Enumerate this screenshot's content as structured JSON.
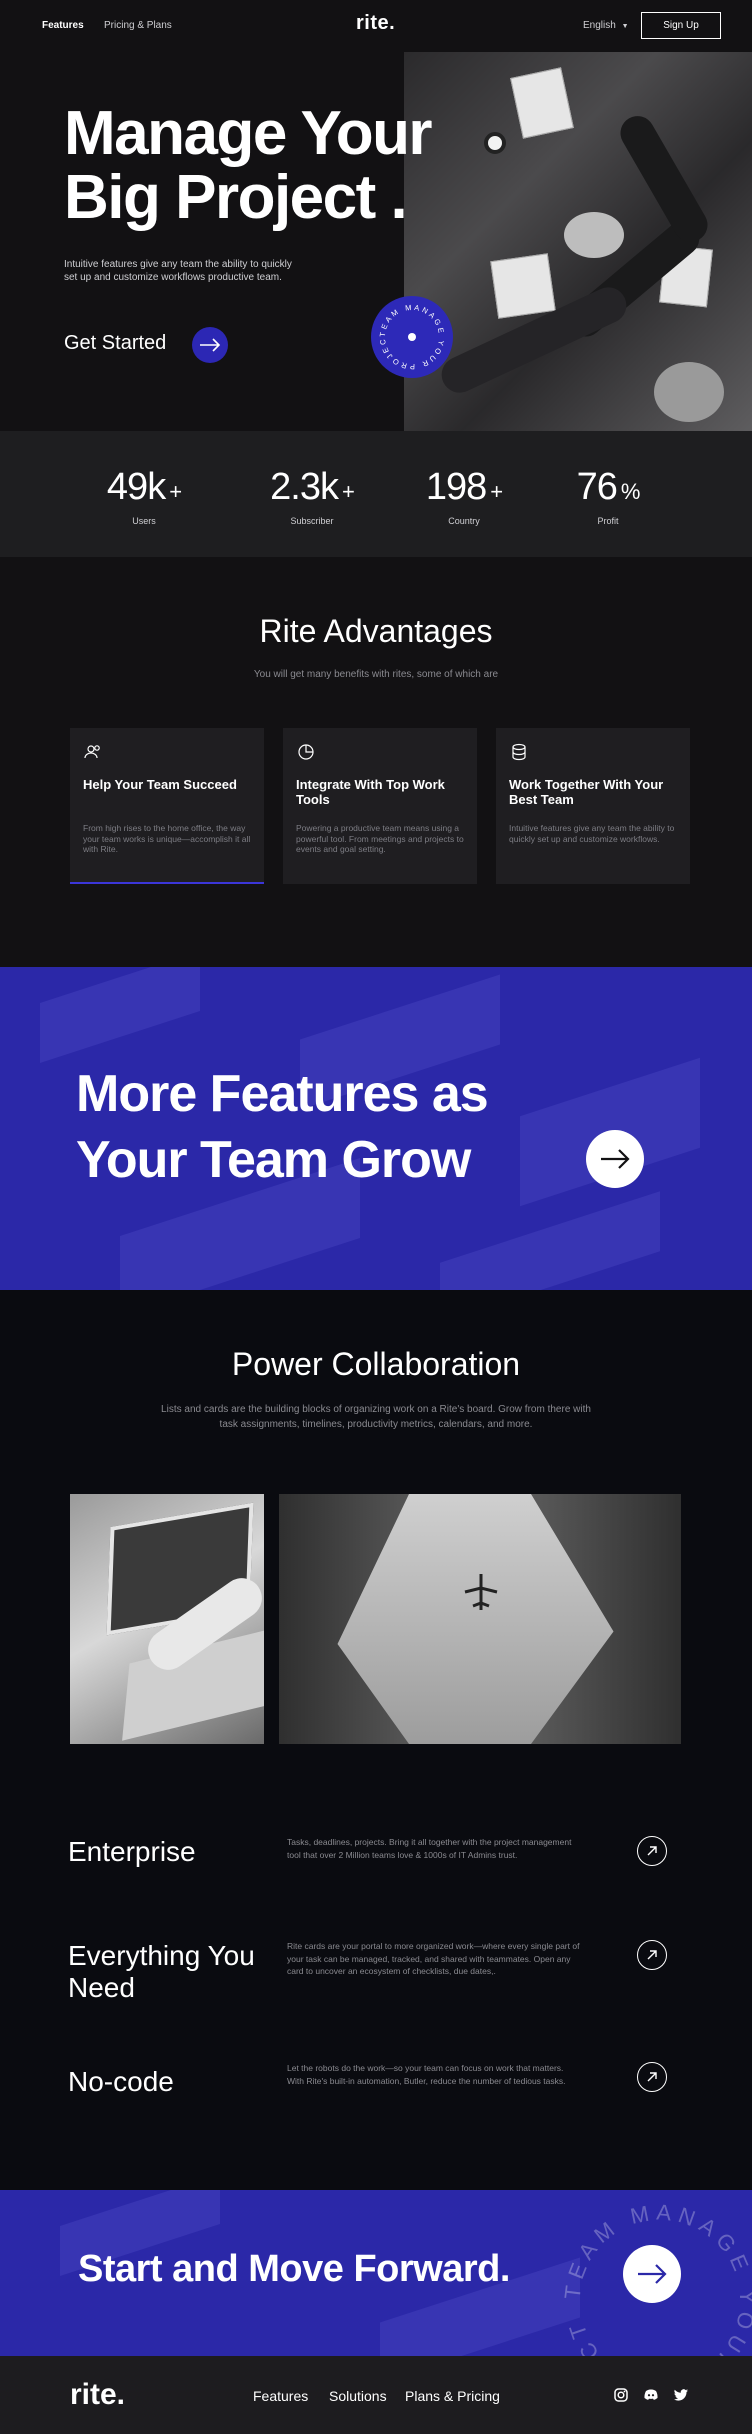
{
  "nav": {
    "features": "Features",
    "pricing": "Pricing & Plans",
    "logo": "rite.",
    "language": "English",
    "signup": "Sign Up"
  },
  "hero": {
    "title_line1": "Manage Your",
    "title_line2": "Big Project .",
    "subtitle": "Intuitive features give any team the ability to quickly set up and customize workflows productive team.",
    "cta": "Get Started",
    "badge_text": "TEAM MANAGE YOUR PROJECT"
  },
  "stats": [
    {
      "value": "49k",
      "suffix": "+",
      "label": "Users"
    },
    {
      "value": "2.3k",
      "suffix": "+",
      "label": "Subscriber"
    },
    {
      "value": "198",
      "suffix": "+",
      "label": "Country"
    },
    {
      "value": "76",
      "suffix": "%",
      "label": "Profit"
    }
  ],
  "advantages": {
    "title": "Rite Advantages",
    "subtitle": "You will get many benefits with rites, some of which are",
    "cards": [
      {
        "icon": "users-icon",
        "title": "Help Your Team Succeed",
        "text": "From high rises to the home office, the way your team works is unique—accomplish it all with Rite."
      },
      {
        "icon": "pie-chart-icon",
        "title": "Integrate With Top Work Tools",
        "text": "Powering a productive team means using a powerful tool. From meetings and projects to events and goal setting."
      },
      {
        "icon": "database-icon",
        "title": "Work Together With Your Best Team",
        "text": "Intuitive features give any team the ability to quickly set up and customize workflows."
      }
    ]
  },
  "features_banner": {
    "line1": "More Features as",
    "line2": "Your Team Grow"
  },
  "collab": {
    "title": "Power Collaboration",
    "subtitle": "Lists and cards are the building blocks of organizing work on a Rite's board. Grow from there with task assignments, timelines, productivity metrics, calendars, and more.",
    "rows": [
      {
        "title": "Enterprise",
        "text": "Tasks, deadlines, projects. Bring it all together with the project management tool that over 2 Million teams love & 1000s of IT Admins trust."
      },
      {
        "title": "Everything You Need",
        "text": "Rite cards are your portal to more organized work—where every single part of your task can be managed, tracked, and shared with teammates. Open any card to uncover an ecosystem of checklists, due dates,."
      },
      {
        "title": "No-code",
        "text": "Let the robots do the work—so your team can focus on work that matters. With Rite's built-in automation, Butler, reduce the number of tedious tasks."
      }
    ]
  },
  "start_banner": {
    "title": "Start and Move Forward.",
    "ring_text": "TEAM MANAGE YOUR PROJECT"
  },
  "footer": {
    "logo": "rite.",
    "links": [
      "Features",
      "Solutions",
      "Plans & Pricing"
    ],
    "social": [
      "instagram-icon",
      "discord-icon",
      "twitter-icon"
    ]
  },
  "colors": {
    "accent": "#2c27b4",
    "banner": "#2b28a8",
    "dark": "#121113"
  }
}
